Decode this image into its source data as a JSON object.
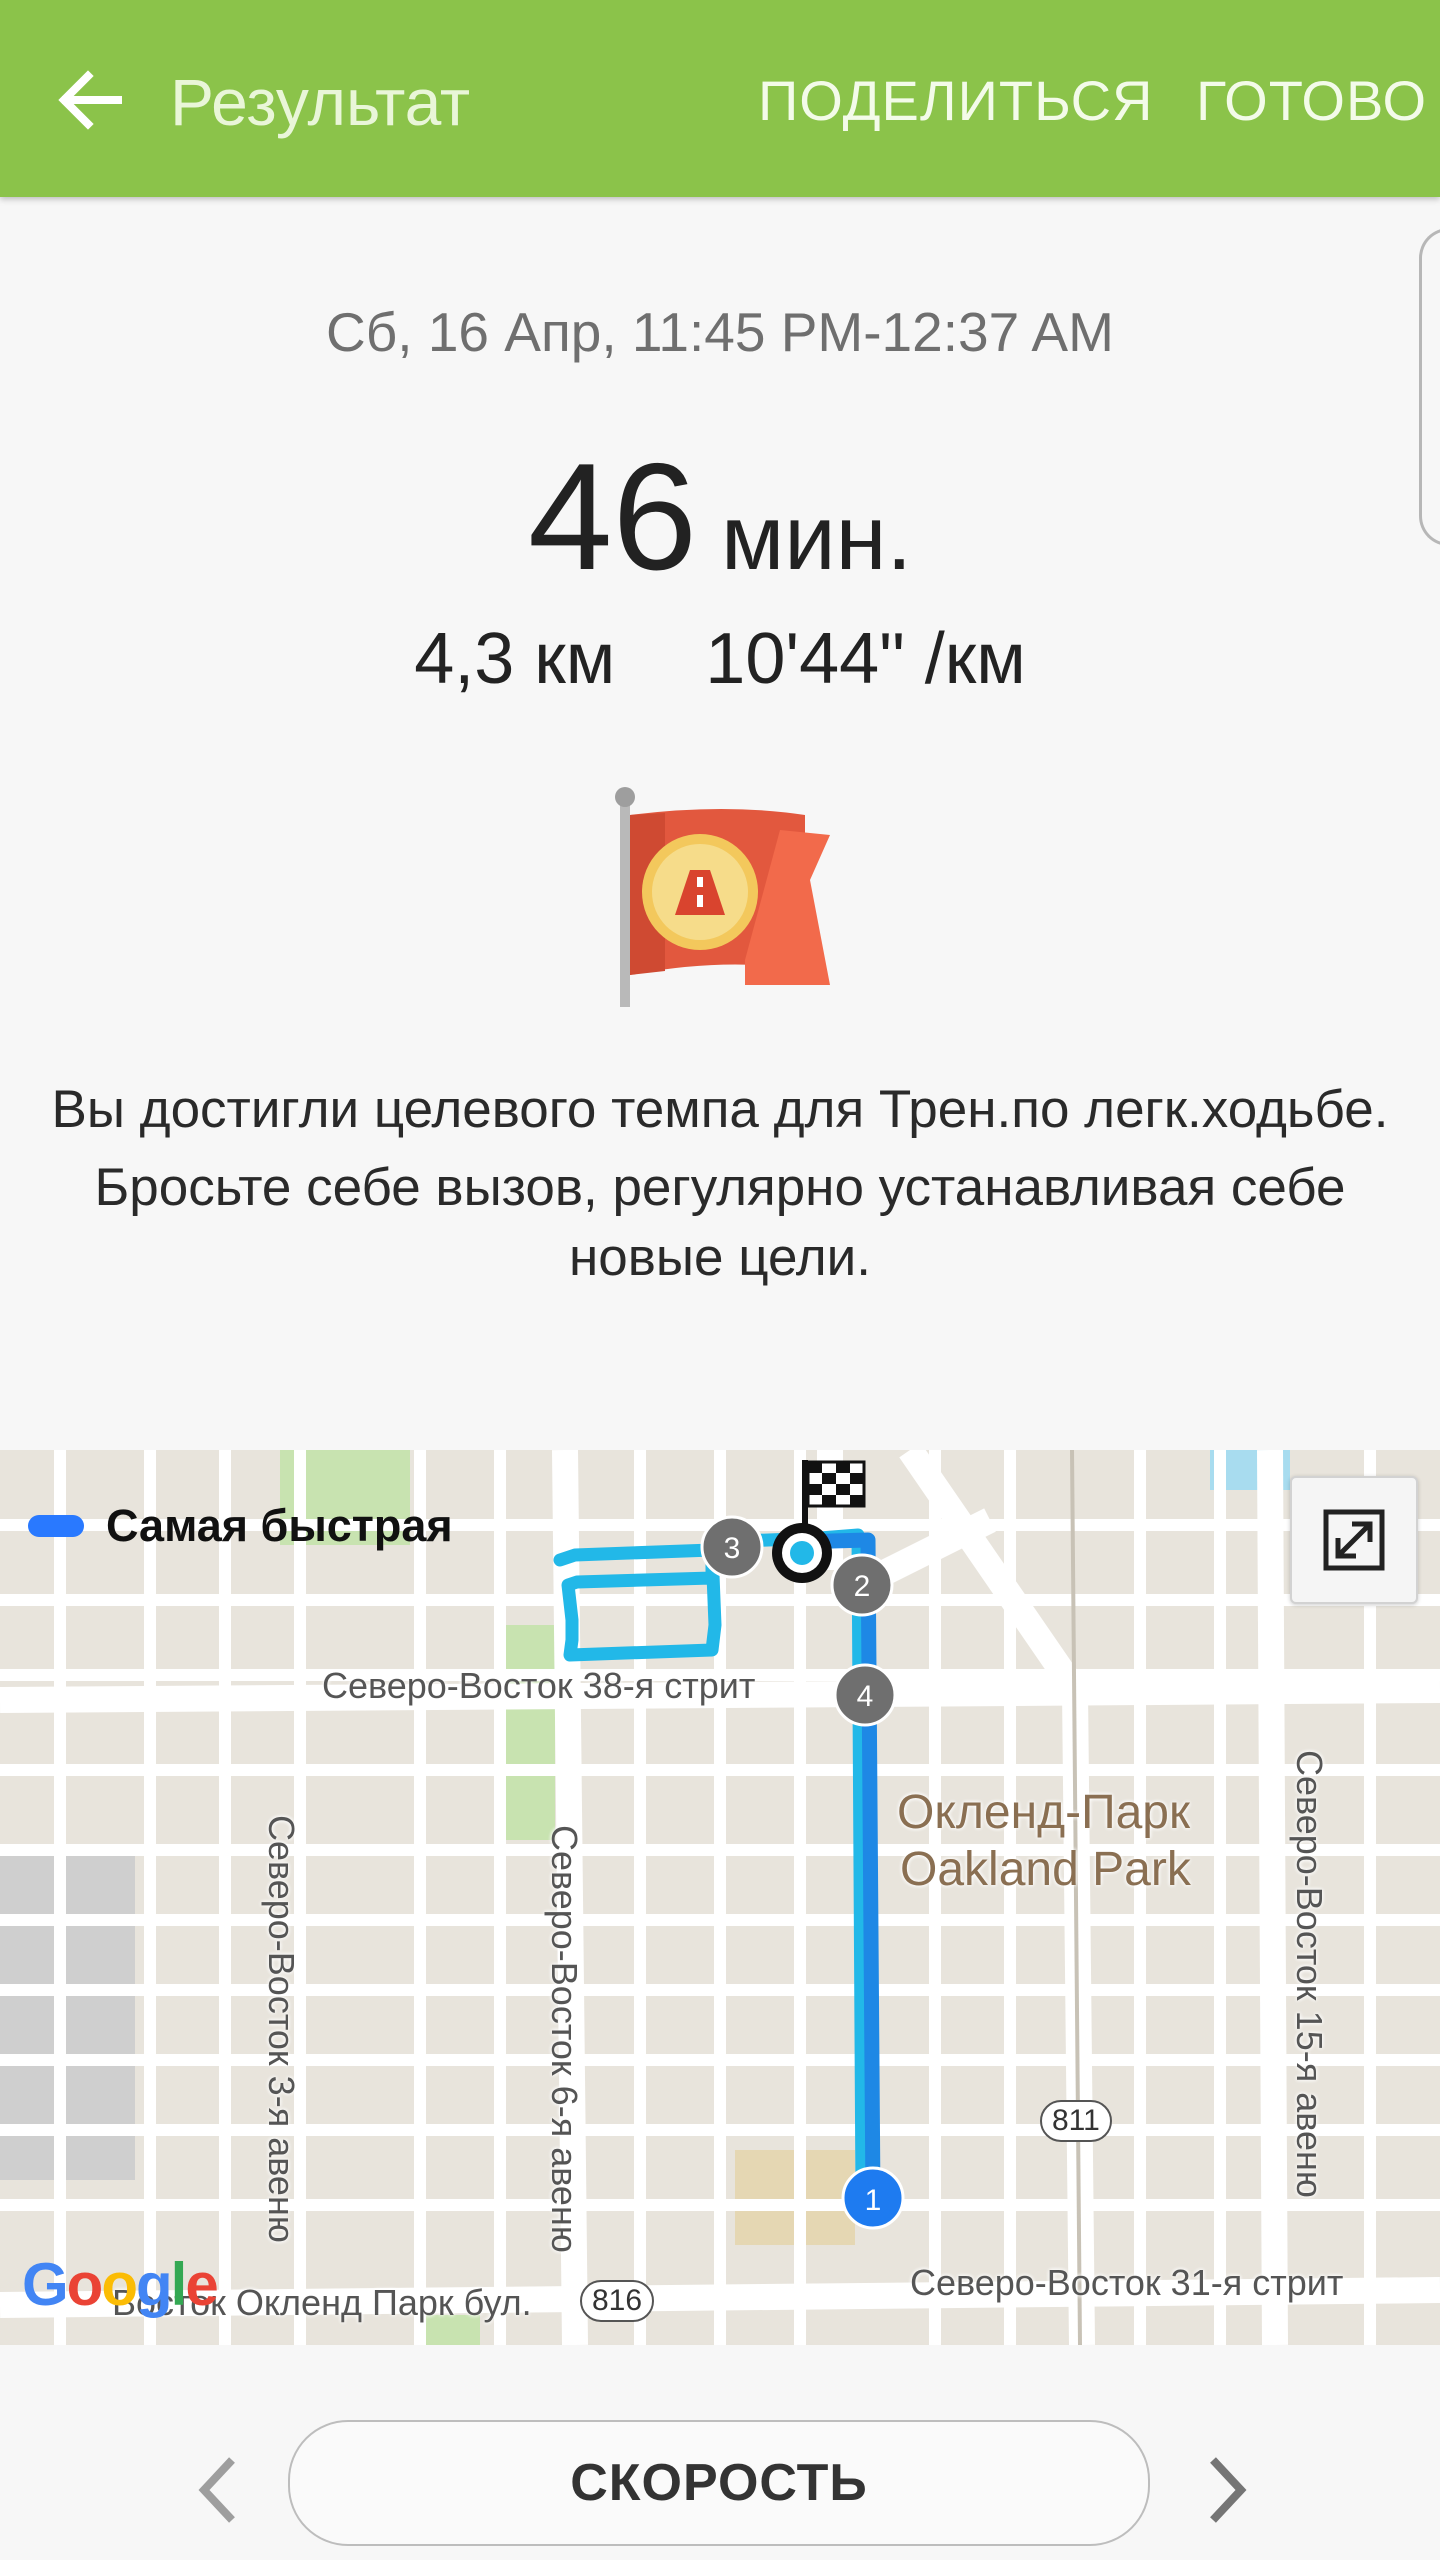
{
  "appbar": {
    "title": "Результат",
    "share_label": "ПОДЕЛИТЬСЯ",
    "done_label": "ГОТОВО",
    "background": "#8bc34a"
  },
  "summary": {
    "date_range": "Сб, 16 Апр, 11:45 PM-12:37 AM",
    "duration_value": "46",
    "duration_unit": "мин.",
    "distance": "4,3 км",
    "pace": "10'44\" /км"
  },
  "achievement": {
    "icon": "target-flag-icon",
    "line1": "Вы достигли целевого темпа для Трен.по легк.ходьбе.",
    "line2": "Бросьте себе вызов, регулярно устанавливая себе новые цели."
  },
  "map": {
    "legend_label": "Самая быстрая",
    "legend_color": "#2979ff",
    "route_color": "#1e88e5",
    "markers": [
      "1",
      "2",
      "3",
      "4"
    ],
    "streets": {
      "ne38": "Северо-Восток 38-я стрит",
      "ne31": "Северо-Восток 31-я стрит",
      "okland_blvd": "Восток Окленд Парк бул.",
      "ne3": "Северо-Восток 3-я авеню",
      "ne6": "Северо-Восток 6-я авеню",
      "ne15": "Северо-Восток 15-я авеню"
    },
    "place_ru": "Окленд-Парк",
    "place_en": "Oakland Park",
    "shield_811": "811",
    "shield_816": "816",
    "google": [
      "G",
      "o",
      "o",
      "g",
      "l",
      "e"
    ]
  },
  "bottom": {
    "metric_button": "СКОРОСТЬ"
  }
}
